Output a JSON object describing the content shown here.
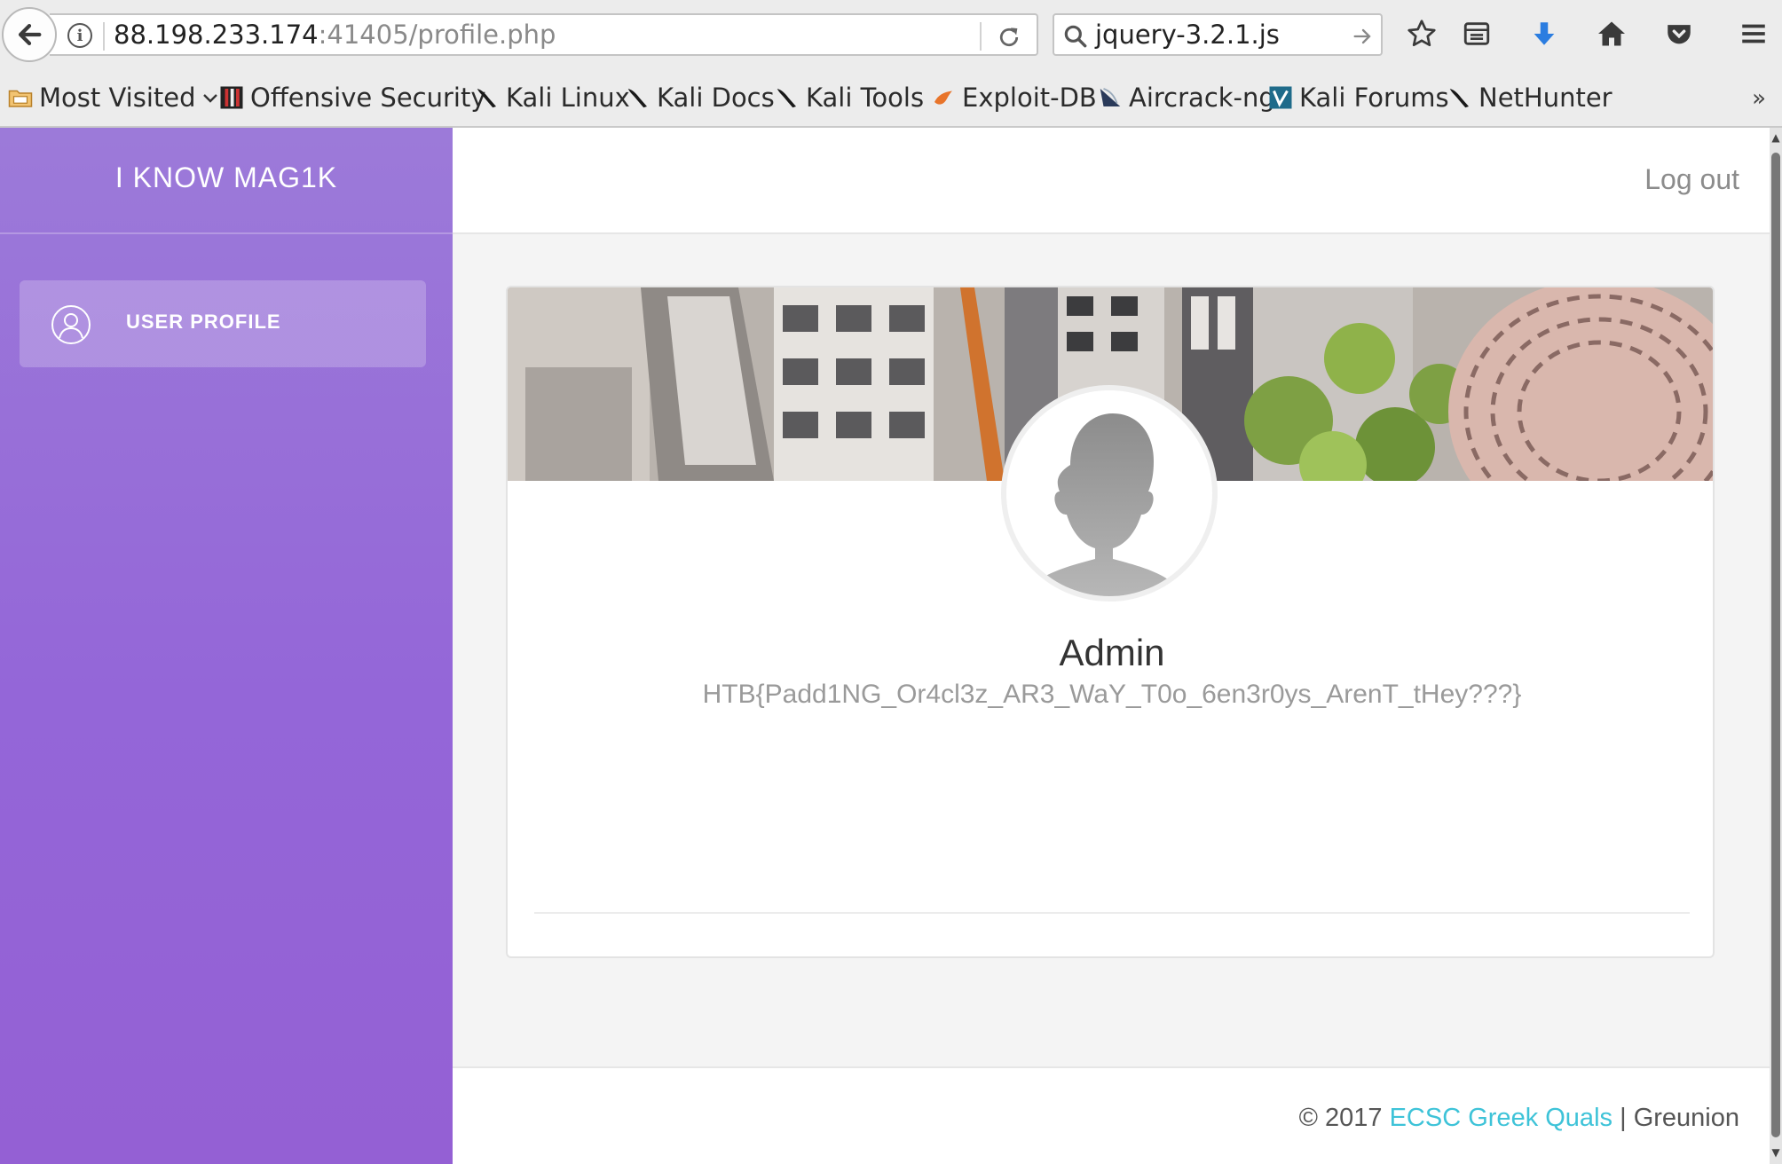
{
  "browser": {
    "url_host": "88.198.233.174",
    "url_path": ":41405/profile.php",
    "search_value": "jquery-3.2.1.js",
    "bookmarks": [
      {
        "label": "Most Visited",
        "icon": "folder-icon"
      },
      {
        "label": "Offensive Security",
        "icon": "offsec-icon"
      },
      {
        "label": "Kali Linux",
        "icon": "kali-dragon-icon"
      },
      {
        "label": "Kali Docs",
        "icon": "kali-dragon-icon"
      },
      {
        "label": "Kali Tools",
        "icon": "kali-dragon-icon"
      },
      {
        "label": "Exploit-DB",
        "icon": "exploitdb-icon"
      },
      {
        "label": "Aircrack-ng",
        "icon": "aircrack-icon"
      },
      {
        "label": "Kali Forums",
        "icon": "kali-forums-icon"
      },
      {
        "label": "NetHunter",
        "icon": "kali-dragon-icon"
      }
    ],
    "overflow_label": "»"
  },
  "sidebar": {
    "brand": "I KNOW MAG1K",
    "items": [
      {
        "label": "USER PROFILE",
        "icon": "user-icon",
        "active": true
      }
    ]
  },
  "header": {
    "logout_label": "Log out"
  },
  "profile": {
    "name": "Admin",
    "flag": "HTB{Padd1NG_Or4cl3z_AR3_WaY_T0o_6en3r0ys_ArenT_tHey???}"
  },
  "footer": {
    "copyright": "© 2017",
    "link_label": "ECSC Greek Quals",
    "separator": "|",
    "author": "Greunion"
  },
  "colors": {
    "sidebar": "#9466d8",
    "link": "#3ec3d8"
  }
}
